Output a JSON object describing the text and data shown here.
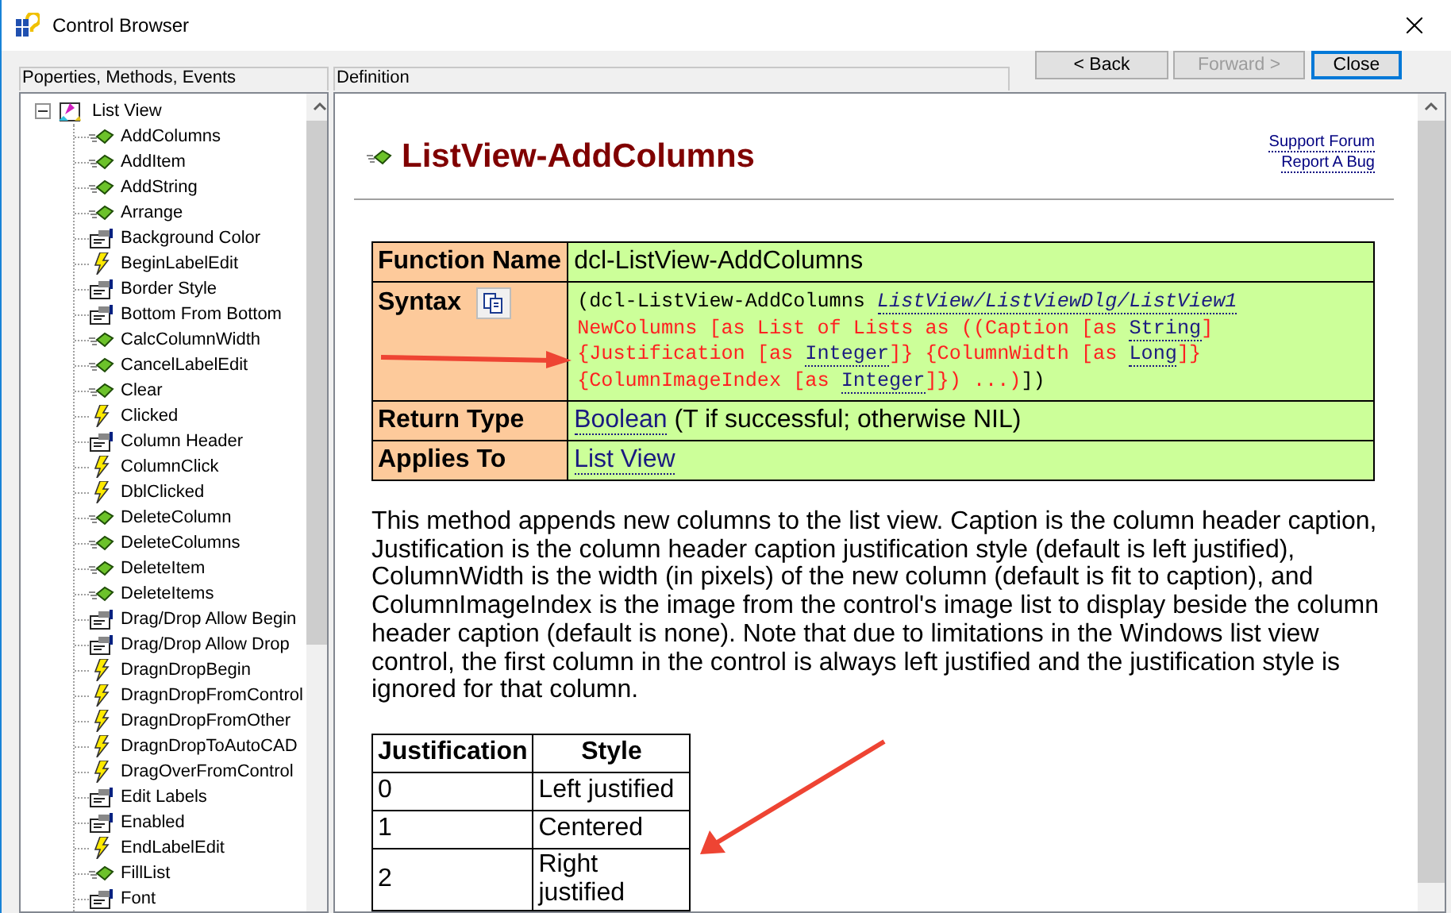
{
  "window": {
    "title": "Control Browser"
  },
  "left_panel": {
    "label": "Poperties, Methods, Events",
    "tree": [
      {
        "label": "List View",
        "kind": "control",
        "expanded": true,
        "selected": false,
        "children": [
          {
            "label": "AddColumns",
            "kind": "method"
          },
          {
            "label": "AddItem",
            "kind": "method"
          },
          {
            "label": "AddString",
            "kind": "method"
          },
          {
            "label": "Arrange",
            "kind": "method"
          },
          {
            "label": "Background Color",
            "kind": "property"
          },
          {
            "label": "BeginLabelEdit",
            "kind": "event"
          },
          {
            "label": "Border Style",
            "kind": "property"
          },
          {
            "label": "Bottom From Bottom",
            "kind": "property"
          },
          {
            "label": "CalcColumnWidth",
            "kind": "method"
          },
          {
            "label": "CancelLabelEdit",
            "kind": "method"
          },
          {
            "label": "Clear",
            "kind": "method"
          },
          {
            "label": "Clicked",
            "kind": "event"
          },
          {
            "label": "Column Header",
            "kind": "property"
          },
          {
            "label": "ColumnClick",
            "kind": "event"
          },
          {
            "label": "DblClicked",
            "kind": "event"
          },
          {
            "label": "DeleteColumn",
            "kind": "method"
          },
          {
            "label": "DeleteColumns",
            "kind": "method"
          },
          {
            "label": "DeleteItem",
            "kind": "method"
          },
          {
            "label": "DeleteItems",
            "kind": "method"
          },
          {
            "label": "Drag/Drop Allow Begin",
            "kind": "property"
          },
          {
            "label": "Drag/Drop Allow Drop",
            "kind": "property"
          },
          {
            "label": "DragnDropBegin",
            "kind": "event"
          },
          {
            "label": "DragnDropFromControl",
            "kind": "event"
          },
          {
            "label": "DragnDropFromOther",
            "kind": "event"
          },
          {
            "label": "DragnDropToAutoCAD",
            "kind": "event"
          },
          {
            "label": "DragOverFromControl",
            "kind": "event"
          },
          {
            "label": "Edit Labels",
            "kind": "property"
          },
          {
            "label": "Enabled",
            "kind": "property"
          },
          {
            "label": "EndLabelEdit",
            "kind": "event"
          },
          {
            "label": "FillList",
            "kind": "method"
          },
          {
            "label": "Font",
            "kind": "property"
          }
        ]
      }
    ]
  },
  "right_panel": {
    "label": "Definition"
  },
  "buttons": [
    {
      "label": "< Back",
      "disabled": false,
      "focused": false
    },
    {
      "label": "Forward >",
      "disabled": true,
      "focused": false
    },
    {
      "label": "Close",
      "disabled": false,
      "focused": true
    }
  ],
  "page": {
    "title": "ListView-AddColumns",
    "links": [
      "Support Forum",
      "Report A Bug"
    ],
    "info_table": [
      {
        "label": "Function Name",
        "kind": "text",
        "value": "dcl-ListView-AddColumns"
      },
      {
        "label": "Syntax",
        "kind": "syntax",
        "lines": [
          [
            {
              "text": "(dcl-ListView-AddColumns ",
              "kind": "plain"
            },
            {
              "text": "ListView/ListViewDlg/ListView1",
              "kind": "arg"
            }
          ],
          [
            {
              "text": "NewColumns [as List of Lists as ((Caption [as ",
              "kind": "red"
            },
            {
              "text": "String",
              "kind": "type"
            },
            {
              "text": "]",
              "kind": "red"
            }
          ],
          [
            {
              "text": "{Justification [as ",
              "kind": "red"
            },
            {
              "text": "Integer",
              "kind": "type"
            },
            {
              "text": "]} {ColumnWidth [as ",
              "kind": "red"
            },
            {
              "text": "Long",
              "kind": "type"
            },
            {
              "text": "]}",
              "kind": "red"
            }
          ],
          [
            {
              "text": "{ColumnImageIndex [as ",
              "kind": "red"
            },
            {
              "text": "Integer",
              "kind": "type"
            },
            {
              "text": "]}) ...)",
              "kind": "red"
            },
            {
              "text": "])",
              "kind": "plain"
            }
          ]
        ]
      },
      {
        "label": "Return Type",
        "kind": "link",
        "link": "Boolean",
        "value": "(T if successful; otherwise NIL)"
      },
      {
        "label": "Applies To",
        "kind": "link",
        "link": "List View"
      }
    ],
    "description": "This method appends new columns to the list view. Caption is the column header caption, Justification is the column header caption justification style (default is left justified), ColumnWidth is the width (in pixels) of the new column (default is fit to caption), and ColumnImageIndex is the image from the control's image list to display beside the column header caption (default is none). Note that due to limitations in the Windows list view control, the first column in the control is always left justified and the justification style is ignored for that column.",
    "style_table": {
      "columns": [
        "Justification",
        "Style"
      ],
      "rows": [
        [
          "0",
          "Left justified"
        ],
        [
          "1",
          "Centered"
        ],
        [
          "2",
          "Right justified"
        ]
      ]
    }
  }
}
